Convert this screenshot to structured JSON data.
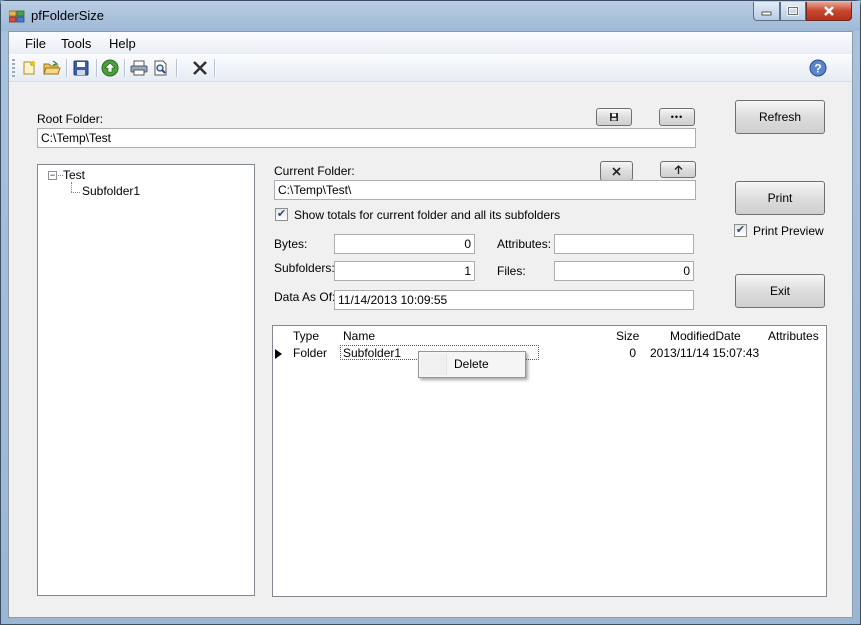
{
  "window": {
    "title": "pfFolderSize"
  },
  "menu": {
    "file": "File",
    "tools": "Tools",
    "help": "Help"
  },
  "toolbar": {
    "items": [
      "new-icon",
      "open-folder-icon",
      "save-icon",
      "up-arrow-icon",
      "print-icon",
      "print-preview-icon",
      "delete-x-icon"
    ],
    "help_icon": "help-icon"
  },
  "root_folder": {
    "label": "Root Folder:",
    "value": "C:\\Temp\\Test"
  },
  "tree": {
    "root": "Test",
    "child": "Subfolder1"
  },
  "current_folder": {
    "label": "Current Folder:",
    "value": "C:\\Temp\\Test\\"
  },
  "show_totals": {
    "label": "Show totals for current folder and all its subfolders",
    "checked": true
  },
  "fields": {
    "bytes_label": "Bytes:",
    "bytes_value": "0",
    "attributes_label": "Attributes:",
    "attributes_value": "",
    "subfolders_label": "Subfolders:",
    "subfolders_value": "1",
    "files_label": "Files:",
    "files_value": "0",
    "data_as_of_label": "Data As Of:",
    "data_as_of_value": "11/14/2013 10:09:55"
  },
  "buttons": {
    "refresh": "Refresh",
    "print": "Print",
    "exit": "Exit",
    "root_browse_icon": "floppy-icon",
    "root_more": "•••",
    "clear_icon": "x-icon",
    "up_icon": "arrow-up-icon"
  },
  "print_preview": {
    "label": "Print Preview",
    "checked": true
  },
  "list": {
    "columns": [
      "Type",
      "Name",
      "Size",
      "ModifiedDate",
      "Attributes"
    ],
    "rows": [
      {
        "type": "Folder",
        "name": "Subfolder1",
        "size": "0",
        "modified": "2013/11/14 15:07:43",
        "attributes": ""
      }
    ]
  },
  "context_menu": {
    "items": [
      "Delete"
    ]
  },
  "colors": {
    "accent": "#3a6ea5",
    "window_bg": "#f0f0f0",
    "titlebar": "#a9c2dc"
  }
}
